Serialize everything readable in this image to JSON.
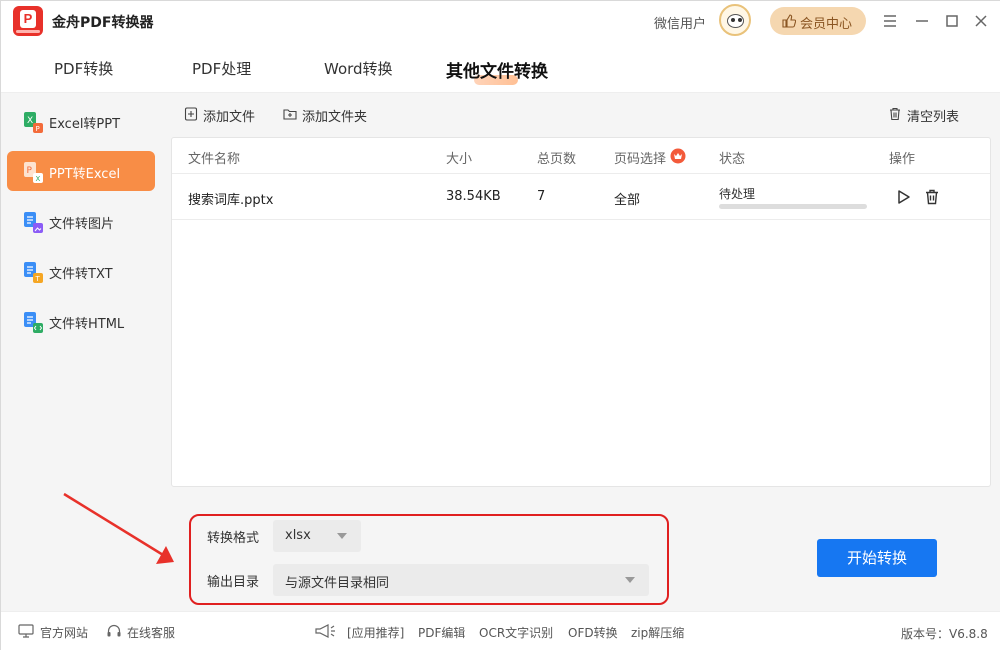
{
  "app": {
    "title": "金舟PDF转换器"
  },
  "header": {
    "user_name": "微信用户",
    "vip_label": "会员中心"
  },
  "tabs": [
    {
      "label": "PDF转换"
    },
    {
      "label": "PDF处理"
    },
    {
      "label": "Word转换"
    },
    {
      "label": "其他文件转换"
    }
  ],
  "sidebar": {
    "items": [
      {
        "label": "Excel转PPT"
      },
      {
        "label": "PPT转Excel"
      },
      {
        "label": "文件转图片"
      },
      {
        "label": "文件转TXT"
      },
      {
        "label": "文件转HTML"
      }
    ]
  },
  "toolbar": {
    "add_file": "添加文件",
    "add_folder": "添加文件夹",
    "clear_list": "清空列表"
  },
  "table": {
    "columns": [
      "文件名称",
      "大小",
      "总页数",
      "页码选择",
      "状态",
      "操作"
    ],
    "rows": [
      {
        "name": "搜索词库.pptx",
        "size": "38.54KB",
        "pages": "7",
        "page_range": "全部",
        "status": "待处理",
        "progress": 0
      }
    ]
  },
  "settings": {
    "format_label": "转换格式",
    "format_value": "xlsx",
    "output_label": "输出目录",
    "output_value": "与源文件目录相同"
  },
  "start_button": "开始转换",
  "footer": {
    "website": "官方网站",
    "service": "在线客服",
    "recommend": "[应用推荐]",
    "apps": [
      "PDF编辑",
      "OCR文字识别",
      "OFD转换",
      "zip解压缩"
    ],
    "version": "版本号：V6.8.8"
  },
  "colors": {
    "accent": "#f88d46",
    "primary": "#1677f2",
    "highlight": "#e02020"
  }
}
